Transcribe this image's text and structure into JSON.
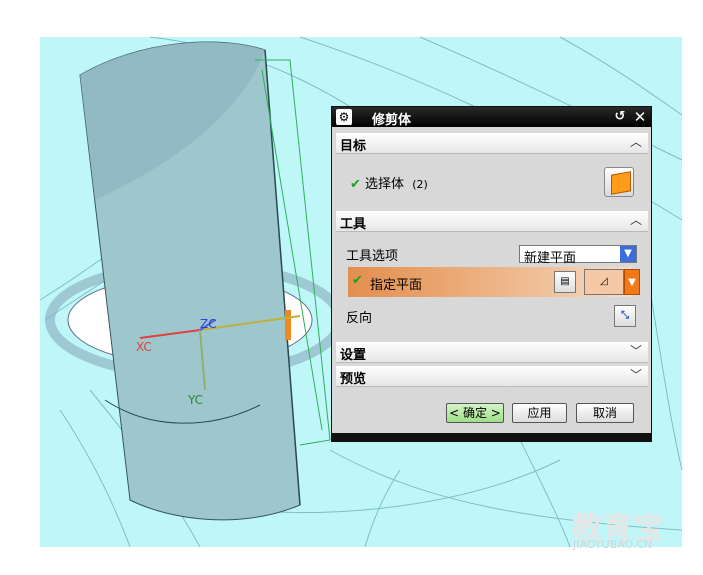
{
  "dialog": {
    "title": "修剪体",
    "sections": {
      "target": {
        "label": "目标",
        "select_body_label": "选择体",
        "select_body_count": "(2)"
      },
      "tool": {
        "label": "工具",
        "tool_option_label": "工具选项",
        "tool_option_value": "新建平面",
        "specify_plane_label": "指定平面",
        "reverse_label": "反向"
      },
      "settings": {
        "label": "设置"
      },
      "preview": {
        "label": "预览"
      }
    },
    "buttons": {
      "ok": "< 确定 >",
      "apply": "应用",
      "cancel": "取消"
    }
  },
  "axes": {
    "x": "XC",
    "y": "YC",
    "z": "ZC"
  },
  "watermark": {
    "main": "教育宝",
    "sub": "JIAOYUBAO.CN"
  },
  "colors": {
    "viewport_bg": "#bff7f9",
    "cylinder": "#9cc7cd",
    "orange": "#f0a060",
    "dialog_bg": "#d8d8d8"
  }
}
